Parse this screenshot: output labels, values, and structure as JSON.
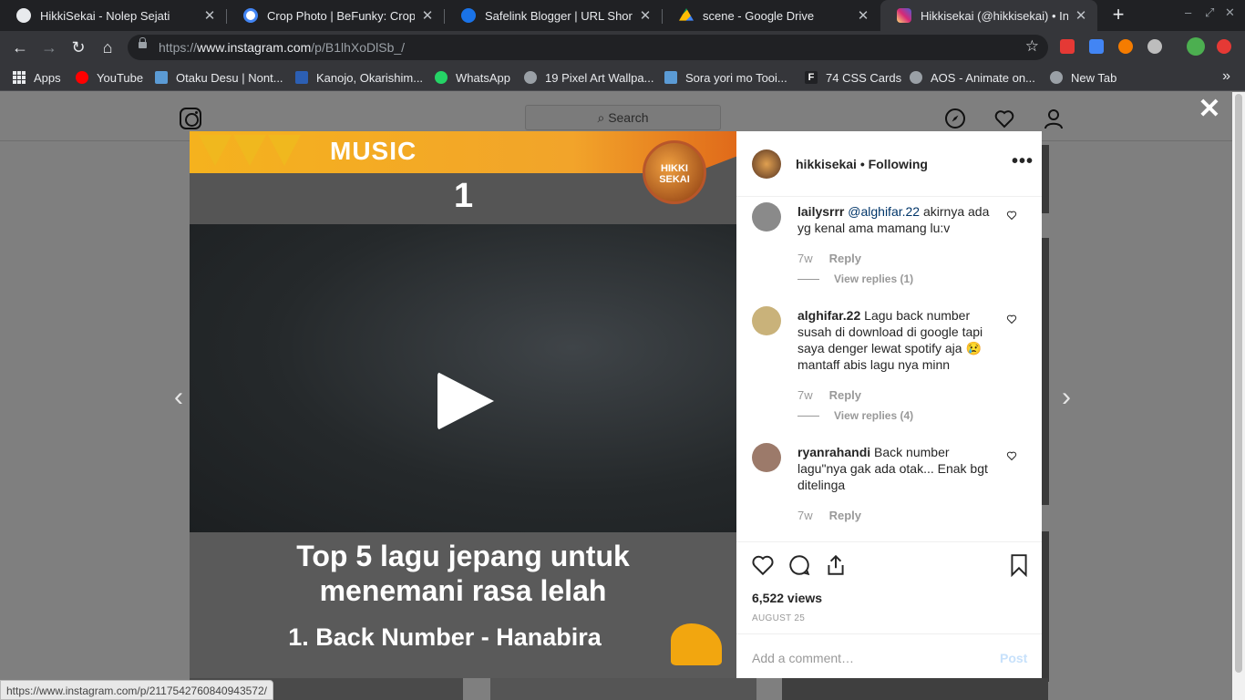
{
  "browser": {
    "tabs": [
      {
        "title": "HikkiSekai - Nolep Sejati",
        "color": "#e8eaed"
      },
      {
        "title": "Crop Photo | BeFunky: Cropping",
        "color": "#4285f4"
      },
      {
        "title": "Safelink Blogger | URL Shortener",
        "color": "#1a73e8"
      },
      {
        "title": "scene - Google Drive",
        "color": "#fbbc04"
      },
      {
        "title": "Hikkisekai (@hikkisekai) • Instagram",
        "color": "#d6249f"
      }
    ],
    "url_scheme": "https://",
    "url_host": "www.instagram.com",
    "url_path": "/p/B1lhXoDlSb_/",
    "bookmarks": [
      {
        "label": "Apps"
      },
      {
        "label": "YouTube",
        "color": "#ff0000"
      },
      {
        "label": "Otaku Desu | Nont...",
        "color": "#5b9bd5"
      },
      {
        "label": "Kanojo, Okarishim...",
        "color": "#2c5fb3"
      },
      {
        "label": "WhatsApp",
        "color": "#25d366"
      },
      {
        "label": "19 Pixel Art Wallpa...",
        "color": "#9aa0a6"
      },
      {
        "label": "Sora yori mo Tooi...",
        "color": "#5b9bd5"
      },
      {
        "label": "74 CSS Cards",
        "color": "#202124"
      },
      {
        "label": "AOS - Animate on...",
        "color": "#9aa0a6"
      },
      {
        "label": "New Tab",
        "color": "#9aa0a6"
      }
    ],
    "status_url": "https://www.instagram.com/p/2117542760840943572/"
  },
  "instagram": {
    "search_placeholder": "Search",
    "post": {
      "username": "hikkisekai",
      "follow_state": "• Following",
      "media": {
        "header_word": "MUSIC",
        "rank": "1",
        "badge_text": "HIKKI SEKAI",
        "caption_line1": "Top 5 lagu jepang untuk",
        "caption_line2": "menemani rasa lelah",
        "caption_line3": "1. Back Number - Hanabira"
      },
      "comments": [
        {
          "user": "lailysrrr",
          "mention": "@alghifar.22",
          "text": "akirnya ada yg kenal ama mamang lu:v",
          "age": "7w",
          "reply": "Reply",
          "view_replies": "View replies (1)",
          "avatar_color": "#8a8a8a"
        },
        {
          "user": "alghifar.22",
          "mention": "",
          "text": "Lagu back number susah di download di google tapi saya denger lewat spotify aja 😢 mantaff abis lagu nya minn",
          "age": "7w",
          "reply": "Reply",
          "view_replies": "View replies (4)",
          "avatar_color": "#c9b27a"
        },
        {
          "user": "ryanrahandi",
          "mention": "",
          "text": "Back number lagu\"nya gak ada otak... Enak bgt ditelinga",
          "age": "7w",
          "reply": "Reply",
          "view_replies": "",
          "avatar_color": "#9c7a6a"
        }
      ],
      "views": "6,522 views",
      "date": "AUGUST 25",
      "add_comment_placeholder": "Add a comment…",
      "post_button": "Post"
    }
  }
}
